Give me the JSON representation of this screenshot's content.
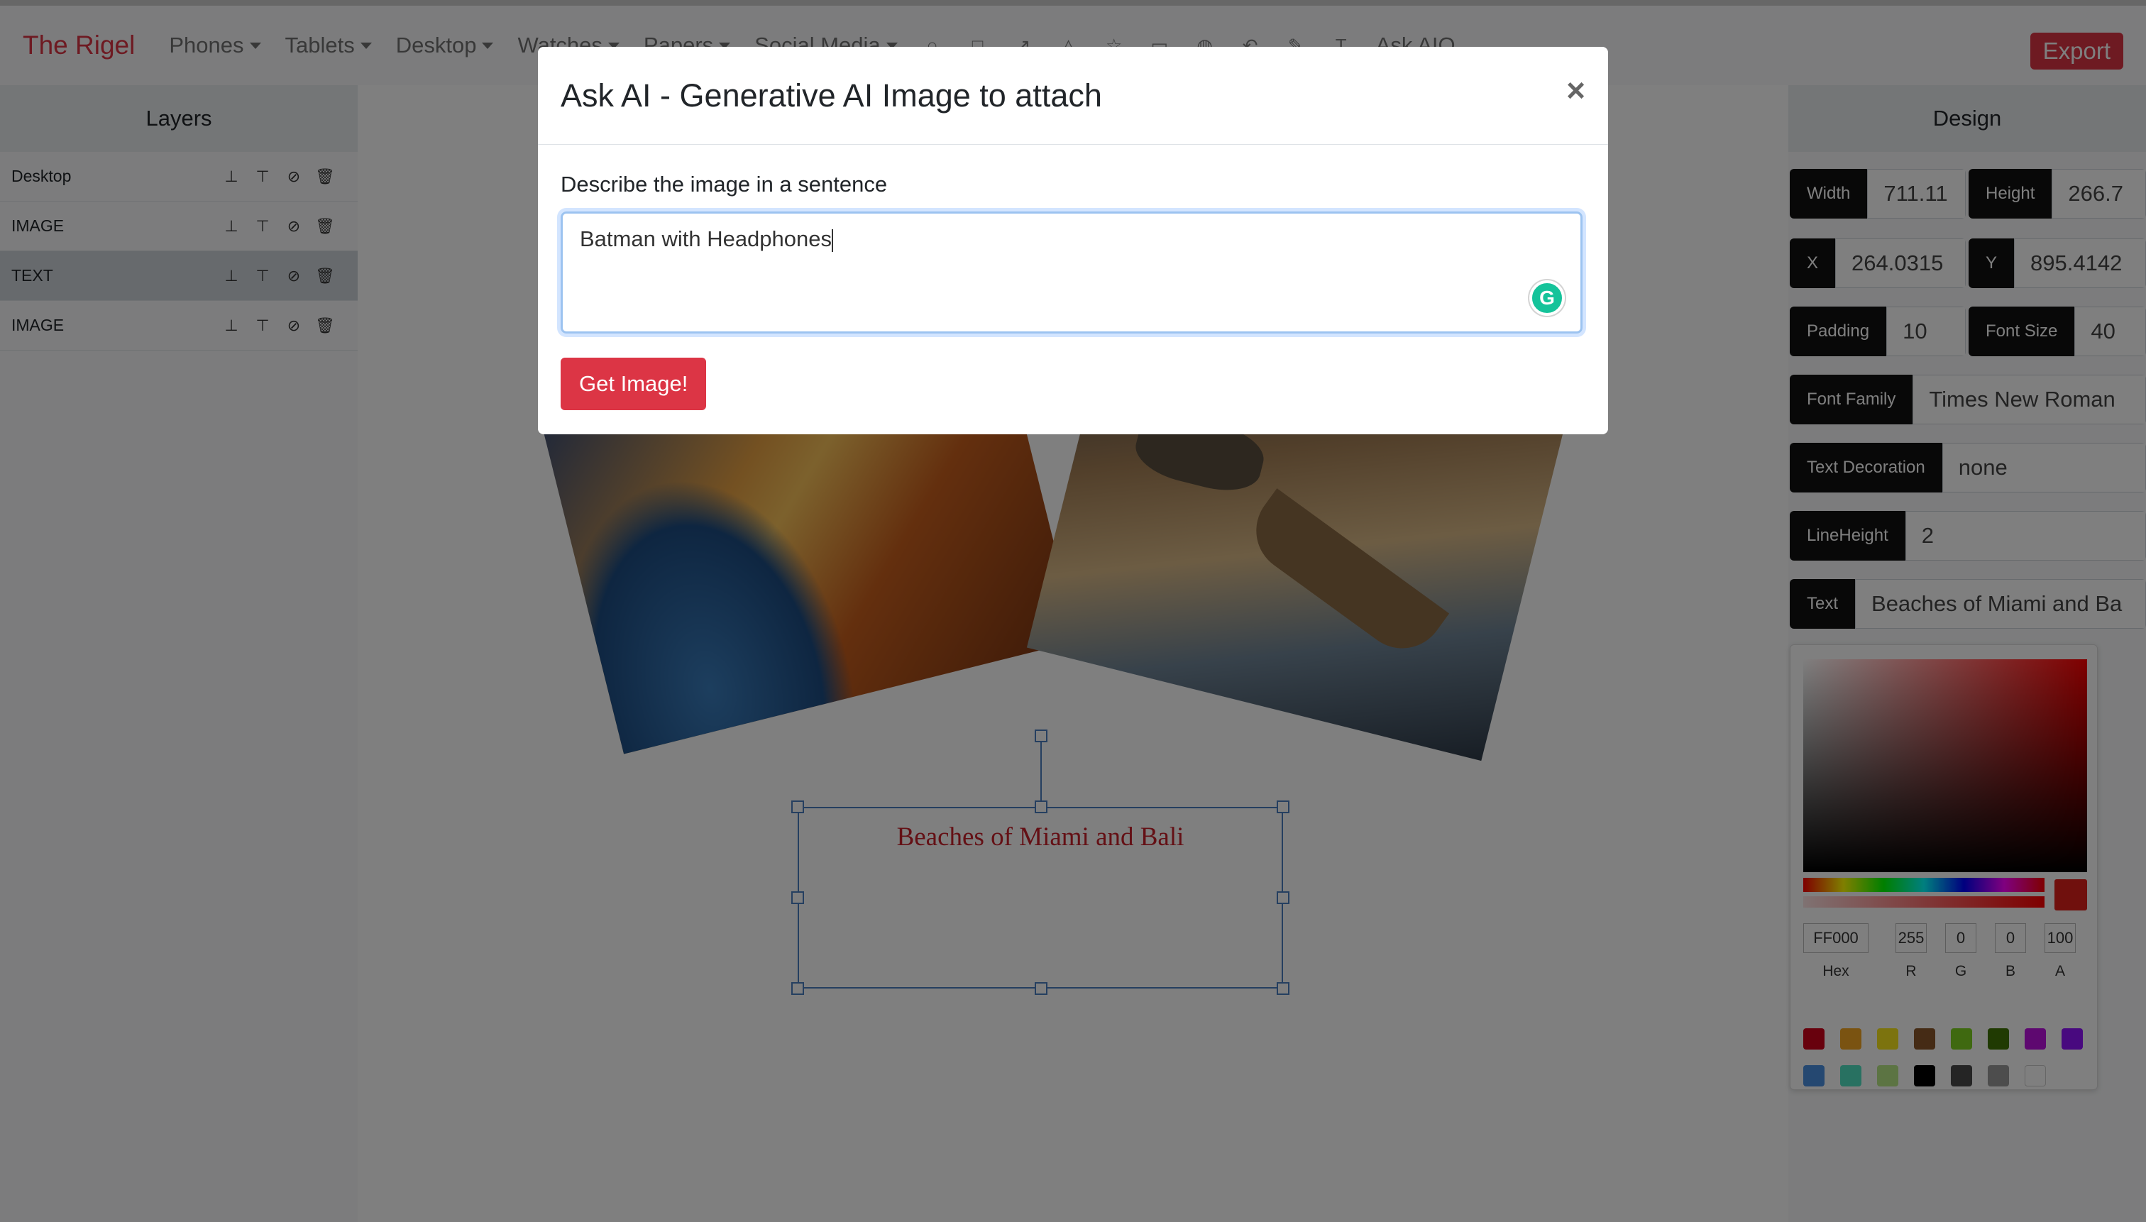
{
  "app": {
    "brand": "The Rigel"
  },
  "nav": {
    "items": [
      {
        "label": "Phones"
      },
      {
        "label": "Tablets"
      },
      {
        "label": "Desktop"
      },
      {
        "label": "Watches"
      },
      {
        "label": "Papers"
      },
      {
        "label": "Social Media"
      }
    ],
    "ask_ai": "Ask AIO",
    "export": "Export"
  },
  "layers": {
    "title": "Layers",
    "items": [
      {
        "label": "Desktop",
        "active": false
      },
      {
        "label": "IMAGE",
        "active": false
      },
      {
        "label": "TEXT",
        "active": true
      },
      {
        "label": "IMAGE",
        "active": false
      }
    ]
  },
  "canvas": {
    "text": "Beaches of Miami and Bali",
    "text_color": "#c8202a"
  },
  "design": {
    "title": "Design",
    "width": {
      "label": "Width",
      "value": "711.11"
    },
    "height": {
      "label": "Height",
      "value": "266.7"
    },
    "x": {
      "label": "X",
      "value": "264.0315"
    },
    "y": {
      "label": "Y",
      "value": "895.4142"
    },
    "padding": {
      "label": "Padding",
      "value": "10"
    },
    "font_size": {
      "label": "Font Size",
      "value": "40"
    },
    "font_family": {
      "label": "Font Family",
      "value": "Times New Roman"
    },
    "text_decoration": {
      "label": "Text Decoration",
      "value": "none"
    },
    "line_height": {
      "label": "LineHeight",
      "value": "2"
    },
    "text": {
      "label": "Text",
      "value": "Beaches of Miami and Ba"
    }
  },
  "color_picker": {
    "hex": "FF000",
    "r": "255",
    "g": "0",
    "b": "0",
    "a": "100",
    "labels": {
      "hex": "Hex",
      "r": "R",
      "g": "G",
      "b": "B",
      "a": "A"
    },
    "swatches": [
      "#d0021b",
      "#f5a623",
      "#f8e71c",
      "#8b572a",
      "#7ed321",
      "#417505",
      "#bd10e0",
      "#9013fe",
      "#4a90e2",
      "#50e3c2",
      "#b8e986",
      "#000000",
      "#4a4a4a",
      "#9b9b9b",
      "#ffffff"
    ]
  },
  "modal": {
    "title": "Ask AI - Generative AI Image to attach",
    "close": "×",
    "prompt_label": "Describe the image in a sentence",
    "prompt_value": "Batman with Headphones",
    "submit": "Get Image!"
  }
}
